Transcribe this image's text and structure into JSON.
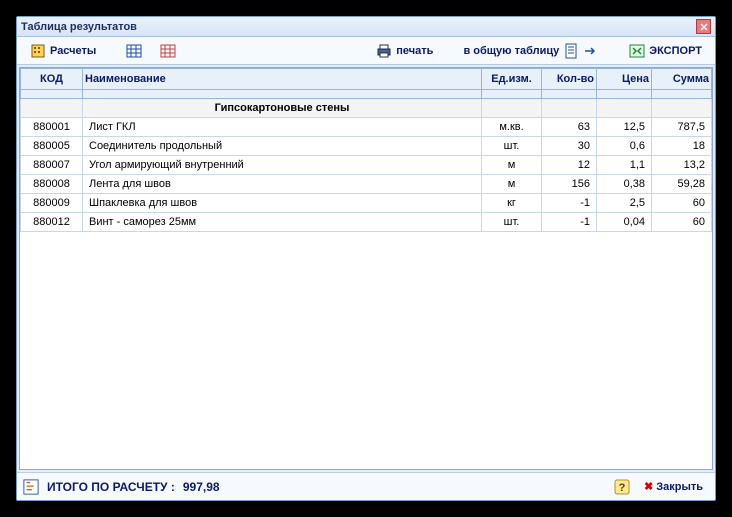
{
  "window": {
    "title": "Таблица результатов"
  },
  "toolbar": {
    "calc": "Расчеты",
    "print": "печать",
    "to_table": "в общую таблицу",
    "export": "ЭКСПОРТ"
  },
  "table": {
    "headers": {
      "code": "КОД",
      "name": "Наименование",
      "unit": "Ед.изм.",
      "qty": "Кол-во",
      "price": "Цена",
      "sum": "Сумма"
    },
    "group": "Гипсокартоновые стены",
    "rows": [
      {
        "code": "880001",
        "name": "Лист ГКЛ",
        "unit": "м.кв.",
        "qty": "63",
        "price": "12,5",
        "sum": "787,5"
      },
      {
        "code": "880005",
        "name": "Соединитель продольный",
        "unit": "шт.",
        "qty": "30",
        "price": "0,6",
        "sum": "18"
      },
      {
        "code": "880007",
        "name": "Угол армирующий внутренний",
        "unit": "м",
        "qty": "12",
        "price": "1,1",
        "sum": "13,2"
      },
      {
        "code": "880008",
        "name": "Лента для швов",
        "unit": "м",
        "qty": "156",
        "price": "0,38",
        "sum": "59,28"
      },
      {
        "code": "880009",
        "name": "Шпаклевка для швов",
        "unit": "кг",
        "qty": "-1",
        "price": "2,5",
        "sum": "60"
      },
      {
        "code": "880012",
        "name": "Винт - саморез 25мм",
        "unit": "шт.",
        "qty": "-1",
        "price": "0,04",
        "sum": "60"
      }
    ]
  },
  "status": {
    "total_label": "ИТОГО ПО РАСЧЕТУ :",
    "total_value": "997,98",
    "close": "Закрыть"
  },
  "chart_data": {
    "type": "table",
    "title": "Таблица результатов",
    "columns": [
      "КОД",
      "Наименование",
      "Ед.изм.",
      "Кол-во",
      "Цена",
      "Сумма"
    ],
    "group": "Гипсокартоновые стены",
    "rows": [
      [
        "880001",
        "Лист ГКЛ",
        "м.кв.",
        63,
        12.5,
        787.5
      ],
      [
        "880005",
        "Соединитель продольный",
        "шт.",
        30,
        0.6,
        18
      ],
      [
        "880007",
        "Угол армирующий внутренний",
        "м",
        12,
        1.1,
        13.2
      ],
      [
        "880008",
        "Лента для швов",
        "м",
        156,
        0.38,
        59.28
      ],
      [
        "880009",
        "Шпаклевка для швов",
        "кг",
        -1,
        2.5,
        60
      ],
      [
        "880012",
        "Винт - саморез 25мм",
        "шт.",
        -1,
        0.04,
        60
      ]
    ],
    "total": 997.98
  }
}
